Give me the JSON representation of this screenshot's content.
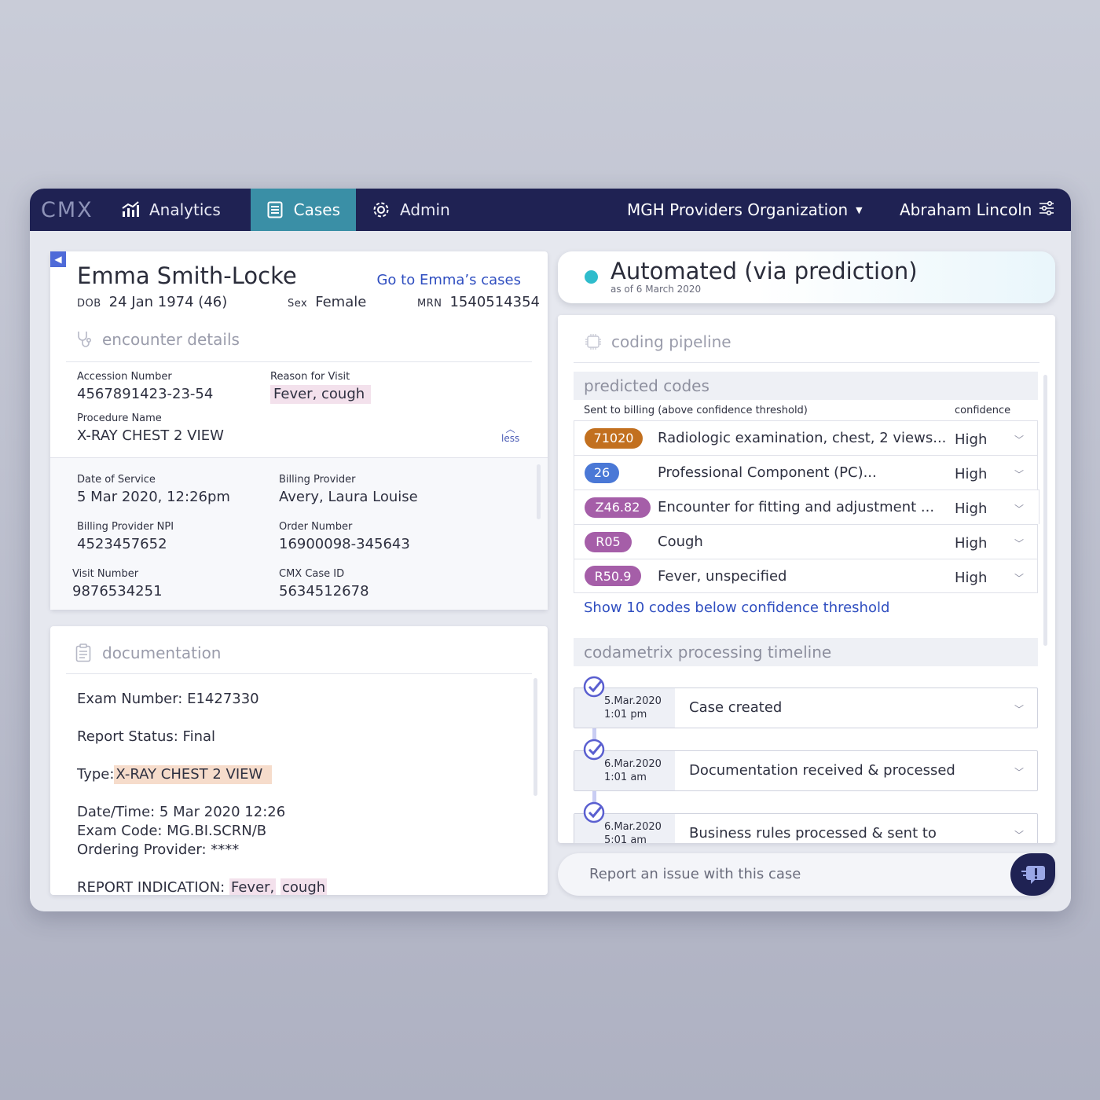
{
  "nav": {
    "logo": "CMX",
    "tabs": [
      {
        "label": "Analytics",
        "icon": "chart-icon"
      },
      {
        "label": "Cases",
        "icon": "document-icon",
        "active": true
      },
      {
        "label": "Admin",
        "icon": "gear-icon"
      }
    ],
    "organization": "MGH Providers Organization",
    "user": "Abraham Lincoln"
  },
  "patient": {
    "name": "Emma Smith-Locke",
    "goto_link": "Go to Emma’s cases",
    "dob_label": "DOB",
    "dob": "24 Jan 1974 (46)",
    "sex_label": "Sex",
    "sex": "Female",
    "mrn_label": "MRN",
    "mrn": "1540514354"
  },
  "encounter": {
    "title": "encounter details",
    "accession_label": "Accession Number",
    "accession": "4567891423-23-54",
    "reason_label": "Reason for Visit",
    "reason": "Fever, cough",
    "procedure_label": "Procedure Name",
    "procedure": "X-RAY CHEST 2 VIEW",
    "less": "less",
    "dos_label": "Date of Service",
    "dos": "5 Mar 2020, 12:26pm",
    "billing_provider_label": "Billing Provider",
    "billing_provider": "Avery, Laura Louise",
    "npi_label": "Billing Provider NPI",
    "npi": "4523457652",
    "order_label": "Order Number",
    "order": "16900098-345643",
    "visit_label": "Visit Number",
    "visit": "9876534251",
    "case_id_label": "CMX Case ID",
    "case_id": "5634512678"
  },
  "documentation": {
    "title": "documentation",
    "exam_number": "Exam Number: E1427330",
    "report_status": "Report Status: Final",
    "type_label": "Type:",
    "type_value": "X-RAY CHEST 2 VIEW",
    "datetime": "Date/Time: 5 Mar 2020 12:26",
    "exam_code": "Exam Code: MG.BI.SCRN/B",
    "ordering_provider": "Ordering Provider: ****",
    "indication_label": "REPORT INDICATION:",
    "indication_1": "Fever,",
    "indication_2": "cough"
  },
  "status": {
    "title": "Automated (via prediction)",
    "subtitle": "as of 6 March 2020",
    "color": "#2fbccc"
  },
  "pipeline": {
    "title": "coding pipeline",
    "predicted_title": "predicted codes",
    "billing_label": "Sent to billing (above confidence threshold)",
    "confidence_label": "confidence",
    "codes": [
      {
        "code": "71020",
        "desc": "Radiologic examination, chest, 2 views...",
        "confidence": "High",
        "color": "#c2701f"
      },
      {
        "code": "26",
        "desc": "Professional Component (PC)...",
        "confidence": "High",
        "color": "#4a78d6"
      },
      {
        "code": "Z46.82",
        "desc": "Encounter for fitting and adjustment ...",
        "confidence": "High",
        "color": "#a55ea8"
      },
      {
        "code": "R05",
        "desc": "Cough",
        "confidence": "High",
        "color": "#a55ea8"
      },
      {
        "code": "R50.9",
        "desc": "Fever, unspecified",
        "confidence": "High",
        "color": "#a55ea8"
      }
    ],
    "show_below": "Show 10 codes below confidence threshold",
    "timeline_title": "codametrix processing timeline",
    "timeline": [
      {
        "date": "5.Mar.2020",
        "time": "1:01 pm",
        "text": "Case created"
      },
      {
        "date": "6.Mar.2020",
        "time": "1:01 am",
        "text": "Documentation received & processed"
      },
      {
        "date": "6.Mar.2020",
        "time": "5:01 am",
        "text": "Business rules processed & sent to"
      }
    ]
  },
  "report": {
    "placeholder": "Report an issue with this case"
  }
}
